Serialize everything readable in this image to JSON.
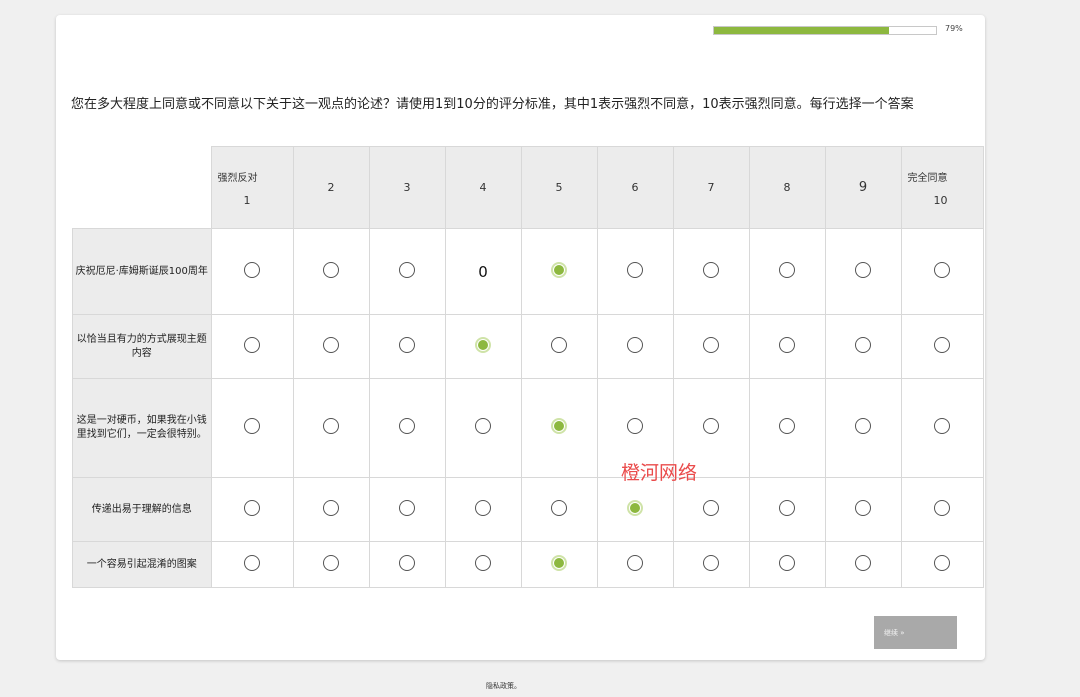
{
  "progress": {
    "percent_label": "79%",
    "fraction": 0.79
  },
  "question": "您在多大程度上同意或不同意以下关于这一观点的论述？请使用1到10分的评分标准，其中1表示强烈不同意，10表示强烈同意。每行选择一个答案",
  "columns": [
    {
      "top": "强烈反对",
      "num": "1"
    },
    {
      "top": "",
      "num": "2"
    },
    {
      "top": "",
      "num": "3"
    },
    {
      "top": "",
      "num": "4"
    },
    {
      "top": "",
      "num": "5"
    },
    {
      "top": "",
      "num": "6"
    },
    {
      "top": "",
      "num": "7"
    },
    {
      "top": "",
      "num": "8"
    },
    {
      "top": "",
      "num": "9"
    },
    {
      "top": "完全同意",
      "num": "10"
    }
  ],
  "rows": [
    {
      "label": "庆祝厄尼·库姆斯诞辰100周年",
      "selected": 5,
      "overlay_col": 4,
      "overlay_text": "0"
    },
    {
      "label": "以恰当且有力的方式展现主题内容",
      "selected": 4
    },
    {
      "label": "这是一对硬币，如果我在小钱里找到它们，一定会很特别。",
      "selected": 5
    },
    {
      "label": "传递出易于理解的信息",
      "selected": 6
    },
    {
      "label": "一个容易引起混淆的图案",
      "selected": 5
    }
  ],
  "watermark": "橙河网络",
  "continue_label": "继续 »",
  "footer": "隐私政策。",
  "colors": {
    "accent": "#8db83f",
    "header_bg": "#ececec",
    "button_bg": "#a9a9a9"
  }
}
